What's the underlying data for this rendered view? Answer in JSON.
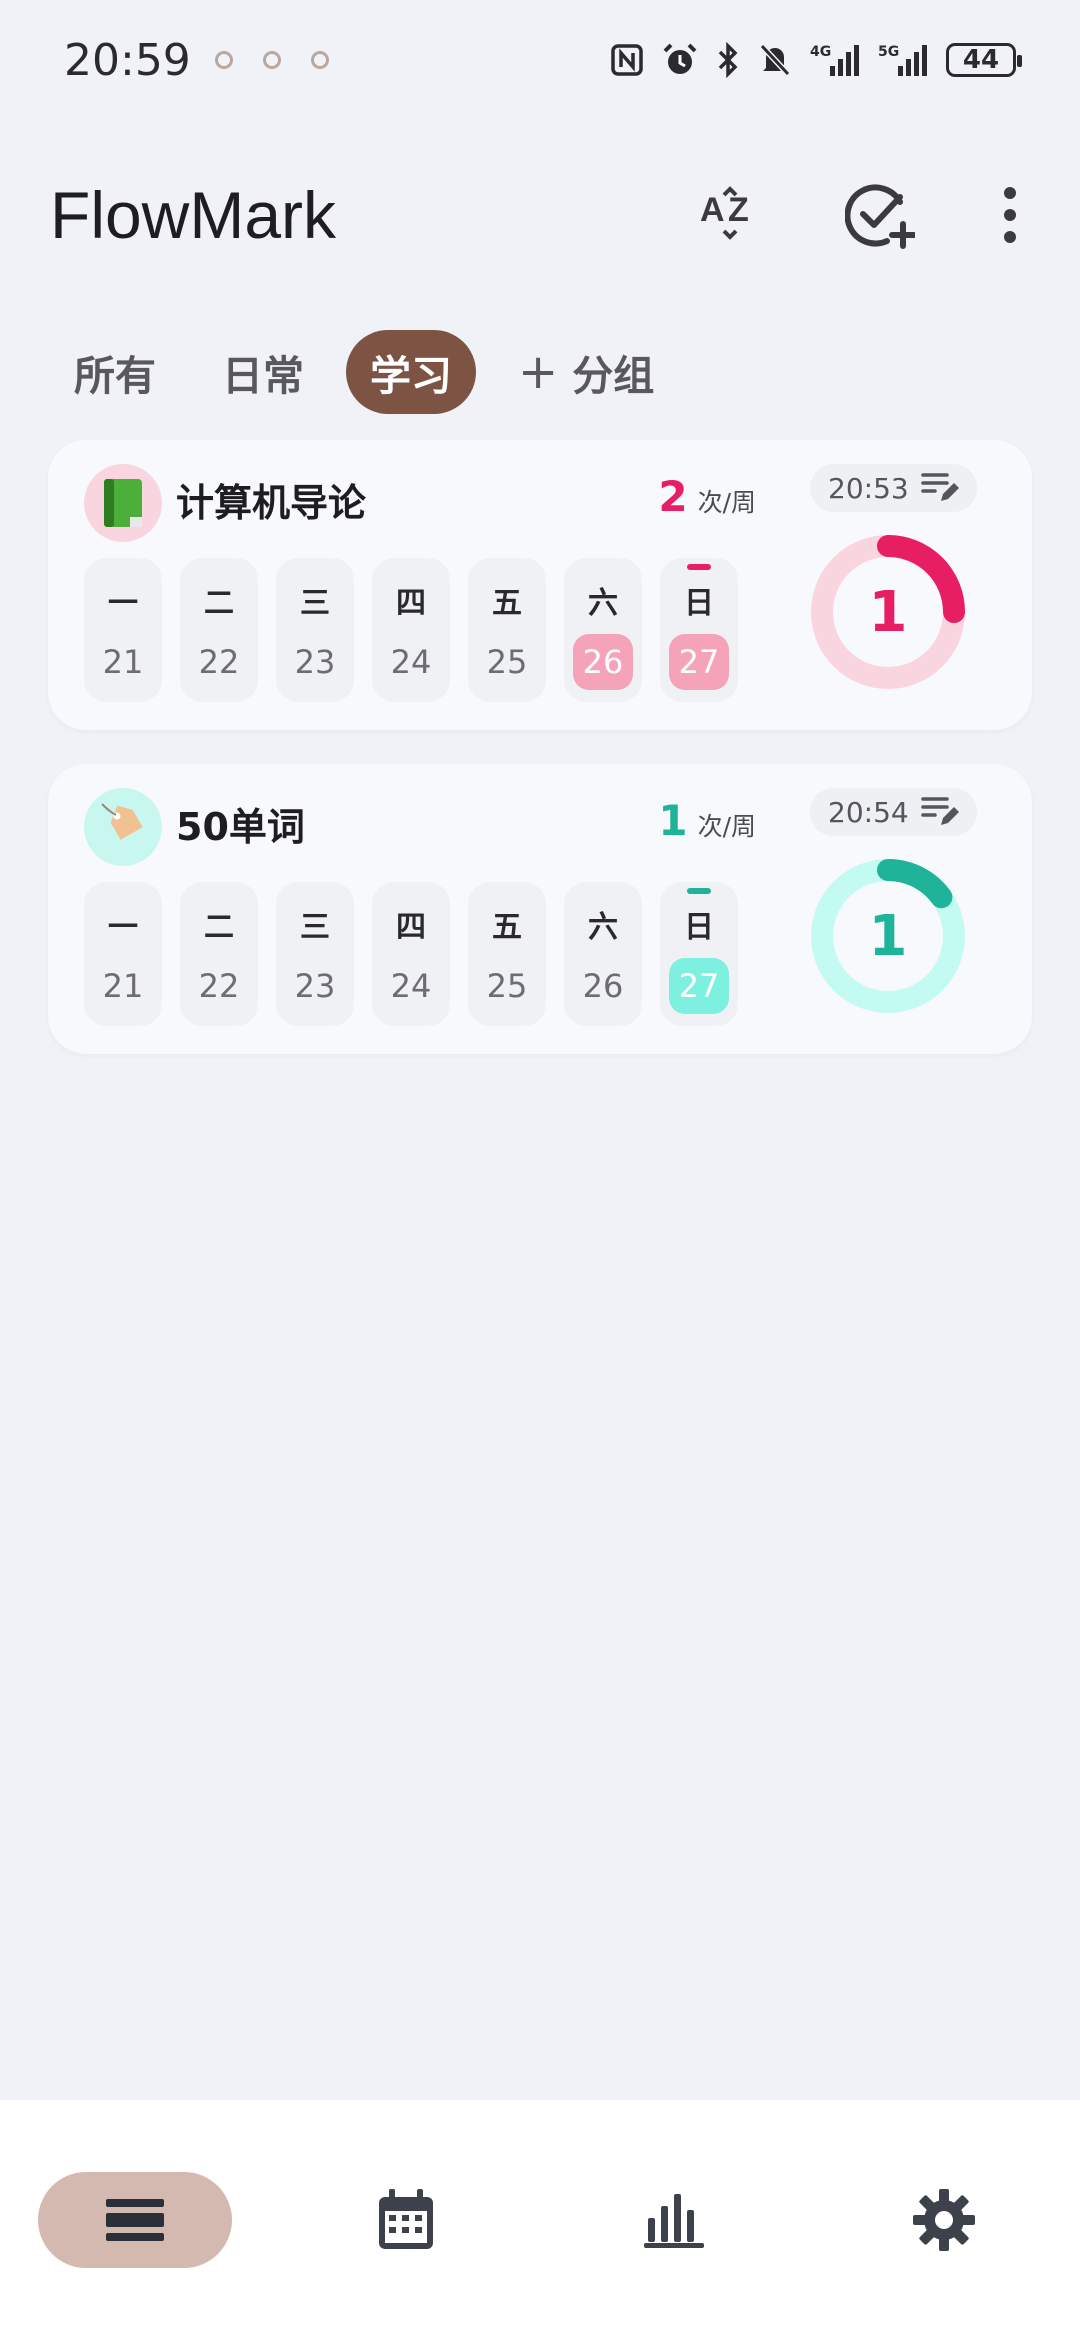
{
  "status_bar": {
    "time": "20:59",
    "battery": "44",
    "icons": [
      "notification-icon",
      "notification-icon",
      "notification-icon",
      "nfc-icon",
      "alarm-icon",
      "bluetooth-icon",
      "mute-icon",
      "signal-4g-icon",
      "signal-5g-icon",
      "battery-icon"
    ]
  },
  "app": {
    "title": "FlowMark",
    "actions": [
      "sort-az-icon",
      "add-habit-icon",
      "more-icon"
    ]
  },
  "tabs": [
    {
      "label": "所有",
      "active": false
    },
    {
      "label": "日常",
      "active": false
    },
    {
      "label": "学习",
      "active": true
    },
    {
      "label": "分组",
      "prefix": "+",
      "active": false
    }
  ],
  "colors": {
    "background": "#f1f2f7",
    "active_tab": "#7d5444",
    "habit1_accent": "#e81e63",
    "habit1_soft": "#f4a3b8",
    "habit2_accent": "#1fb39a",
    "habit2_soft": "#7ef0e0",
    "nav_active": "#d4b9b0"
  },
  "habits": [
    {
      "icon": "green-book-icon",
      "name": "计算机导论",
      "frequency": "2",
      "frequency_unit": "次/周",
      "time": "20:53",
      "count": "1",
      "progress": 0.25,
      "days": [
        {
          "name": "一",
          "date": "21",
          "done": false
        },
        {
          "name": "二",
          "date": "22",
          "done": false
        },
        {
          "name": "三",
          "date": "23",
          "done": false
        },
        {
          "name": "四",
          "date": "24",
          "done": false
        },
        {
          "name": "五",
          "date": "25",
          "done": false
        },
        {
          "name": "六",
          "date": "26",
          "done": true
        },
        {
          "name": "日",
          "date": "27",
          "done": true,
          "today": true
        }
      ]
    },
    {
      "icon": "tag-icon",
      "name": "50单词",
      "frequency": "1",
      "frequency_unit": "次/周",
      "time": "20:54",
      "count": "1",
      "progress": 0.15,
      "days": [
        {
          "name": "一",
          "date": "21",
          "done": false
        },
        {
          "name": "二",
          "date": "22",
          "done": false
        },
        {
          "name": "三",
          "date": "23",
          "done": false
        },
        {
          "name": "四",
          "date": "24",
          "done": false
        },
        {
          "name": "五",
          "date": "25",
          "done": false
        },
        {
          "name": "六",
          "date": "26",
          "done": false
        },
        {
          "name": "日",
          "date": "27",
          "done": true,
          "today": true
        }
      ]
    }
  ],
  "bottom_nav": [
    {
      "icon": "list-icon",
      "active": true
    },
    {
      "icon": "calendar-icon",
      "active": false
    },
    {
      "icon": "bar-chart-icon",
      "active": false
    },
    {
      "icon": "settings-icon",
      "active": false
    }
  ]
}
